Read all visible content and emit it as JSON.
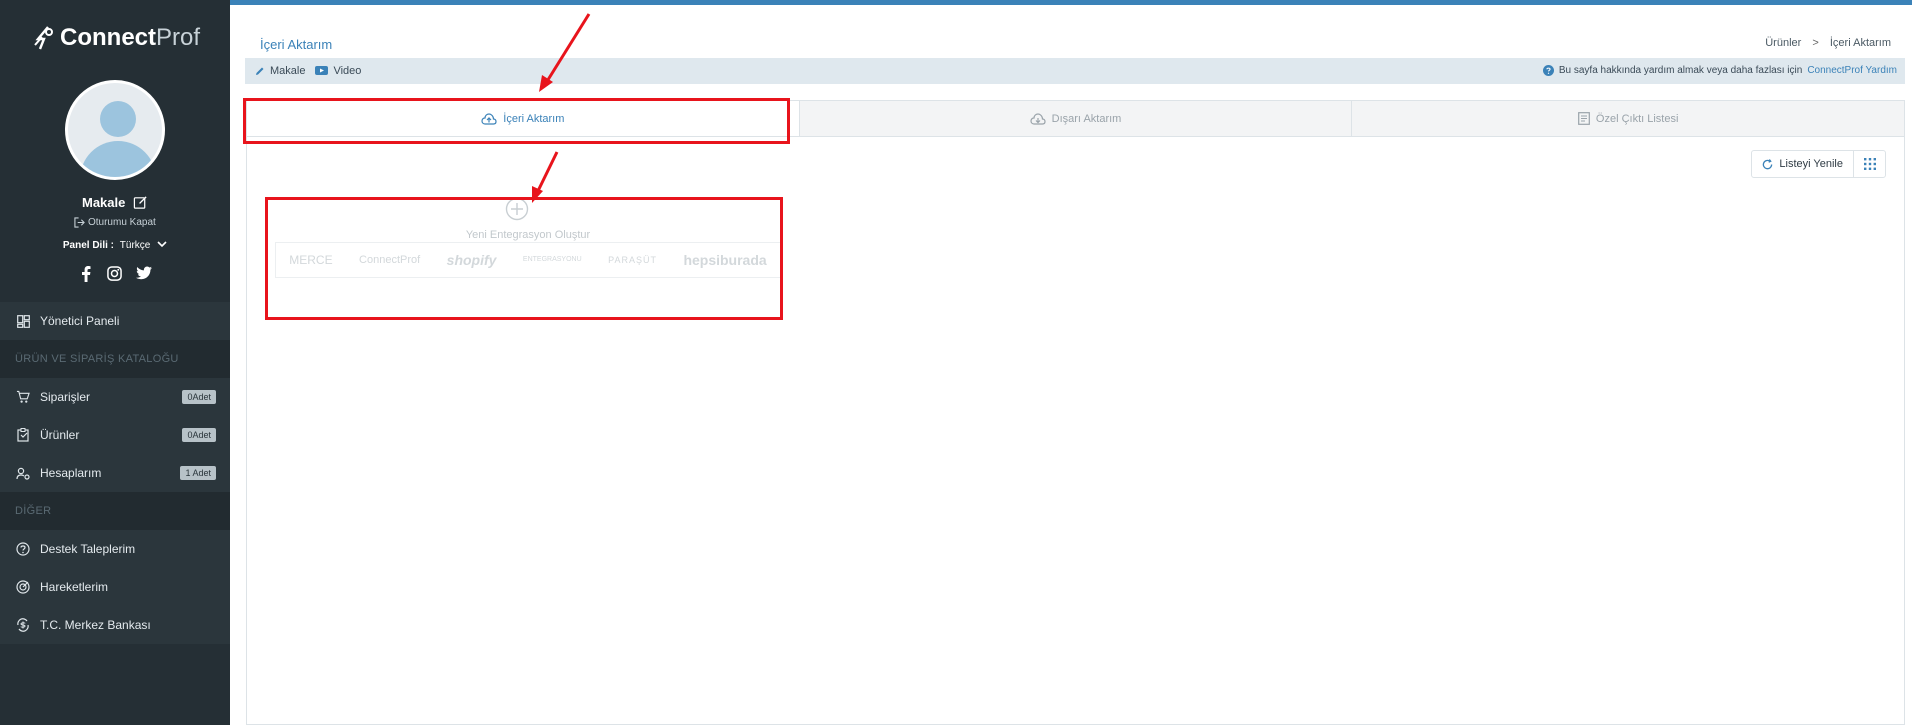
{
  "sidebar": {
    "logo_bold": "Connect",
    "logo_light": "Prof",
    "user_name": "Makale",
    "logout": "Oturumu Kapat",
    "lang_label": "Panel Dili :",
    "lang_value": "Türkçe",
    "items": [
      {
        "label": "Yönetici Paneli",
        "icon": "dashboard-icon"
      },
      {
        "section": "ÜRÜN VE SİPARİŞ KATALOĞU"
      },
      {
        "label": "Siparişler",
        "icon": "cart-icon",
        "badge": "0Adet"
      },
      {
        "label": "Ürünler",
        "icon": "clipboard-icon",
        "badge": "0Adet"
      },
      {
        "label": "Hesaplarım",
        "icon": "user-settings-icon",
        "badge": "1 Adet"
      },
      {
        "section": "DİĞER"
      },
      {
        "label": "Destek Taleplerim",
        "icon": "help-circle-icon"
      },
      {
        "label": "Hareketlerim",
        "icon": "activity-icon"
      },
      {
        "label": "T.C. Merkez Bankası",
        "icon": "currency-exchange-icon"
      }
    ]
  },
  "header": {
    "title": "İçeri Aktarım",
    "breadcrumb": [
      "Ürünler",
      ">",
      "İçeri Aktarım"
    ]
  },
  "helpbar": {
    "article": "Makale",
    "video": "Video",
    "help_text": "Bu sayfa hakkında yardım almak veya daha fazlası için",
    "help_link": "ConnectProf Yardım"
  },
  "tabs": [
    "İçeri Aktarım",
    "Dışarı Aktarım",
    "Özel Çıktı Listesi"
  ],
  "toolbar": {
    "refresh": "Listeyi Yenile"
  },
  "new_integration": {
    "label": "Yeni Entegrasyon Oluştur",
    "brands": [
      "MERCE",
      "ConnectProf",
      "shopify",
      "ENTEGRASYONU",
      "PARAŞÜT",
      "hepsiburada"
    ]
  },
  "colors": {
    "accent": "#3b82b8",
    "sidebar": "#252f35",
    "annotation": "#e8141c"
  }
}
